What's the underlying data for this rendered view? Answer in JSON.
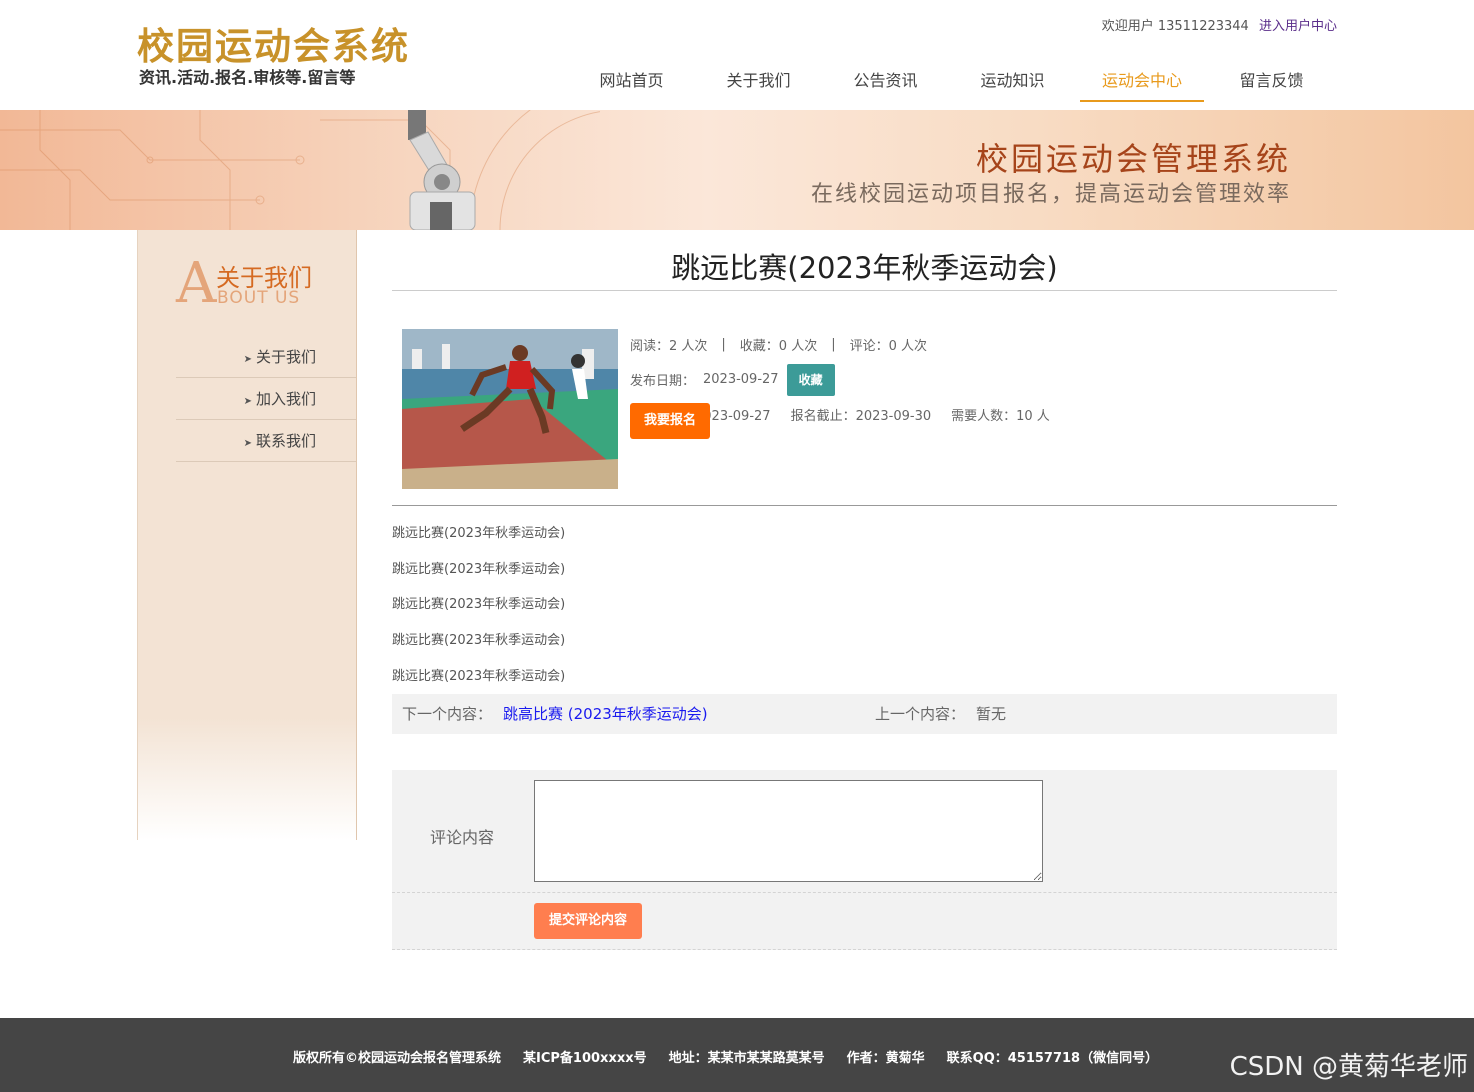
{
  "header": {
    "site_title": "校园运动会系统",
    "site_subtitle": "资讯.活动.报名.审核等.留言等",
    "welcome_text": "欢迎用户 13511223344",
    "user_center_link": "进入用户中心"
  },
  "nav": {
    "items": [
      "网站首页",
      "关于我们",
      "公告资讯",
      "运动知识",
      "运动会中心",
      "留言反馈"
    ],
    "active": "运动会中心"
  },
  "banner": {
    "title": "校园运动会管理系统",
    "subtitle": "在线校园运动项目报名，提高运动会管理效率"
  },
  "sidebar": {
    "big_letter": "A",
    "title_cn": "关于我们",
    "title_en": "BOUT US",
    "items": [
      "关于我们",
      "加入我们",
      "联系我们"
    ]
  },
  "article": {
    "title": "跳远比赛(2023年秋季运动会)",
    "stats": {
      "reads": "阅读：2 人次",
      "favorites": "收藏：0 人次",
      "comments": "评论：0 人次",
      "separator": "|"
    },
    "publish_label": "发布日期：",
    "publish_date": "2023-09-27",
    "favorite_button": "收藏",
    "signup_start": "报名开始：2023-09-27",
    "signup_end": "报名截止：2023-09-30",
    "people_needed": "需要人数：10 人",
    "signup_button": "我要报名",
    "content_lines": [
      "跳远比赛(2023年秋季运动会)",
      "跳远比赛(2023年秋季运动会)",
      "跳远比赛(2023年秋季运动会)",
      "跳远比赛(2023年秋季运动会)",
      "跳远比赛(2023年秋季运动会)"
    ]
  },
  "pager": {
    "next_label": "下一个内容：",
    "next_link": "跳高比赛 (2023年秋季运动会)",
    "prev_label": "上一个内容：",
    "prev_value": "暂无"
  },
  "comment": {
    "label": "评论内容",
    "placeholder": "",
    "submit_button": "提交评论内容"
  },
  "footer": {
    "copyright": "版权所有©校园运动会报名管理系统",
    "icp": "某ICP备100xxxx号",
    "address": "地址：某某市某某路莫某号",
    "author": "作者：黄菊华",
    "qq": "联系QQ：45157718（微信同号）"
  },
  "watermark": "CSDN @黄菊华老师",
  "colors": {
    "brand_gold": "#c8922a",
    "nav_active": "#e89a1c",
    "favorite_button": "#3c9b98",
    "signup_button": "#ff6a00",
    "submit_button": "#ff7e4f",
    "footer_bg": "#454545"
  }
}
